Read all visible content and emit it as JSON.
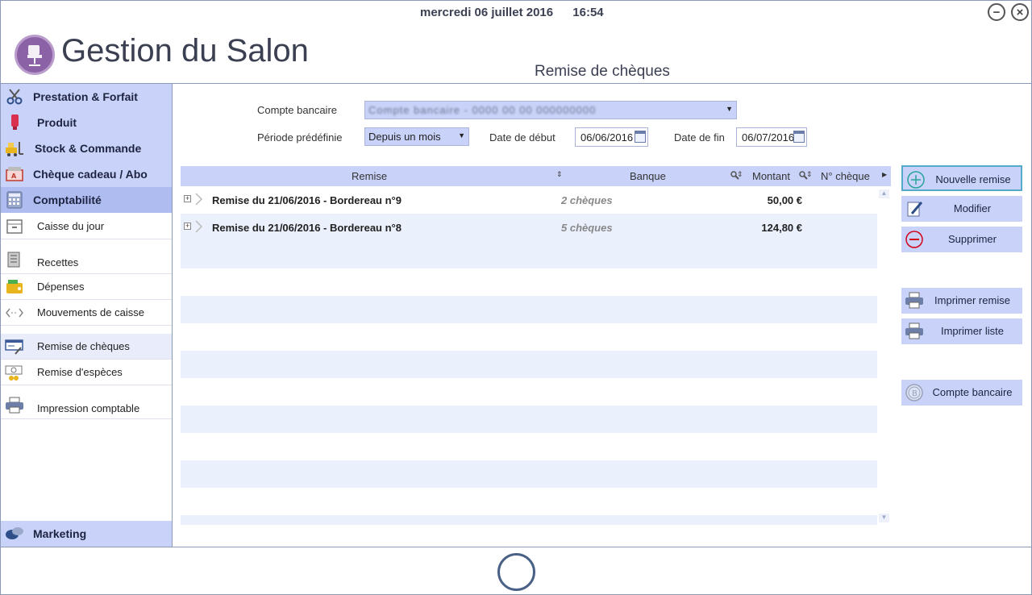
{
  "header": {
    "date": "mercredi 06 juillet 2016",
    "time": "16:54",
    "app_title": "Gestion du Salon",
    "page_title": "Remise de chèques"
  },
  "sidebar": {
    "categories": [
      {
        "label": "Prestation & Forfait",
        "icon": "scissors-icon"
      },
      {
        "label": "Produit",
        "icon": "product-tube-icon"
      },
      {
        "label": "Stock & Commande",
        "icon": "forklift-icon"
      },
      {
        "label": "Chèque cadeau / Abo",
        "icon": "gift-card-icon"
      },
      {
        "label": "Comptabilité",
        "icon": "calculator-icon"
      }
    ],
    "items": [
      {
        "label": "Caisse du jour",
        "icon": "cash-box-icon"
      },
      {
        "label": "Recettes",
        "icon": "receipt-icon"
      },
      {
        "label": "Dépenses",
        "icon": "wallet-icon"
      },
      {
        "label": "Mouvements de caisse",
        "icon": "transfer-arrows-icon"
      },
      {
        "label": "Remise de chèques",
        "icon": "cheque-icon"
      },
      {
        "label": "Remise d'espèces",
        "icon": "banknotes-icon"
      },
      {
        "label": "Impression comptable",
        "icon": "printer-icon"
      }
    ],
    "footer_category": {
      "label": "Marketing",
      "icon": "chat-bubbles-icon"
    }
  },
  "filters": {
    "account_label": "Compte bancaire",
    "account_value": "Compte bancaire - 0000 00 00 000000000",
    "period_label": "Période prédéfinie",
    "period_value": "Depuis un mois",
    "start_label": "Date de début",
    "start_value": "06/06/2016",
    "end_label": "Date de fin",
    "end_value": "06/07/2016"
  },
  "table": {
    "columns": [
      "Remise",
      "Banque",
      "Montant",
      "N° chèque"
    ],
    "rows": [
      {
        "name": "Remise du 21/06/2016  -  Bordereau n°9",
        "bank": "2 chèques",
        "amount": "50,00 €"
      },
      {
        "name": "Remise du 21/06/2016  -  Bordereau n°8",
        "bank": "5 chèques",
        "amount": "124,80 €"
      }
    ]
  },
  "actions": {
    "new": "Nouvelle remise",
    "edit": "Modifier",
    "delete": "Supprimer",
    "print_remise": "Imprimer remise",
    "print_list": "Imprimer liste",
    "bank_account": "Compte bancaire"
  },
  "colors": {
    "accent": "#c9d3f9",
    "border": "#8a9ab8",
    "logo": "#8c62a6",
    "delete_red": "#d0021b",
    "new_green": "#2aa39a"
  }
}
